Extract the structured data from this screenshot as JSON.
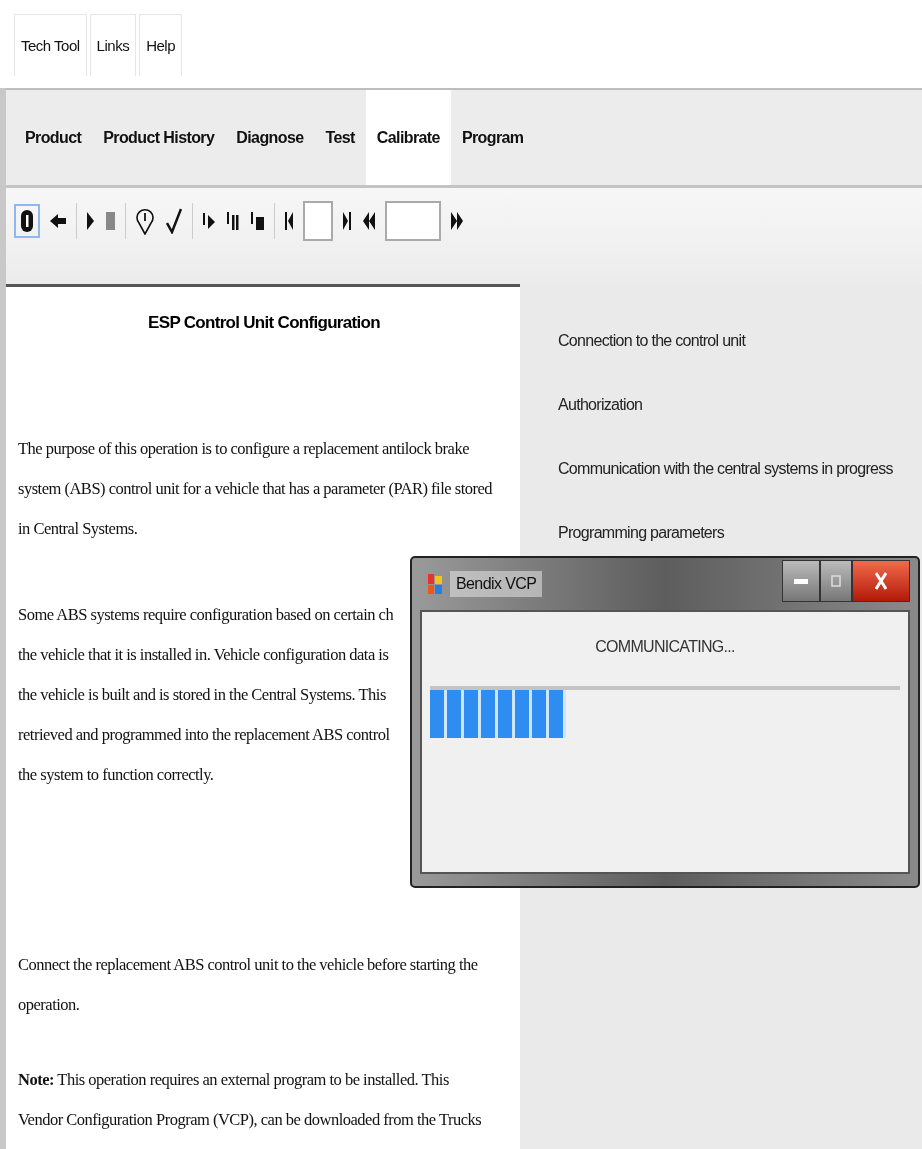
{
  "menu": [
    {
      "label": "Tech Tool"
    },
    {
      "label": "Links"
    },
    {
      "label": "Help"
    }
  ],
  "tabs": [
    {
      "label": "Product",
      "selected": false
    },
    {
      "label": "Product History",
      "selected": false
    },
    {
      "label": "Diagnose",
      "selected": false
    },
    {
      "label": "Test",
      "selected": false
    },
    {
      "label": "Calibrate",
      "selected": true
    },
    {
      "label": "Program",
      "selected": false
    }
  ],
  "document": {
    "title": "ESP Control Unit Configuration",
    "paragraphs": [
      {
        "lines": [
          "The purpose of this operation is to configure a replacement antilock brake",
          "system (ABS) control unit for a vehicle that has a parameter (PAR) file stored",
          "in Central Systems."
        ]
      },
      {
        "lines": [
          "Some ABS systems require configuration based on certain ch",
          "the vehicle that it is installed in. Vehicle configuration data is",
          "the vehicle is built and is stored in the Central Systems. This",
          "retrieved and programmed into the replacement ABS control",
          "the system to function correctly."
        ]
      },
      {
        "lines": [
          "Connect the replacement ABS control unit to the vehicle before starting the",
          "operation."
        ]
      },
      {
        "lines": [
          "**Note:** This operation requires an external program to be installed. This",
          "Vendor Configuration Program (VCP), can be downloaded from the Trucks"
        ]
      }
    ]
  },
  "steps": [
    "Connection to the control unit",
    "Authorization",
    "Communication with the central systems in progress",
    "Programming parameters"
  ],
  "dialog": {
    "title": "Bendix VCP",
    "status": "COMMUNICATING...",
    "progress": {
      "level": 0.29
    }
  }
}
